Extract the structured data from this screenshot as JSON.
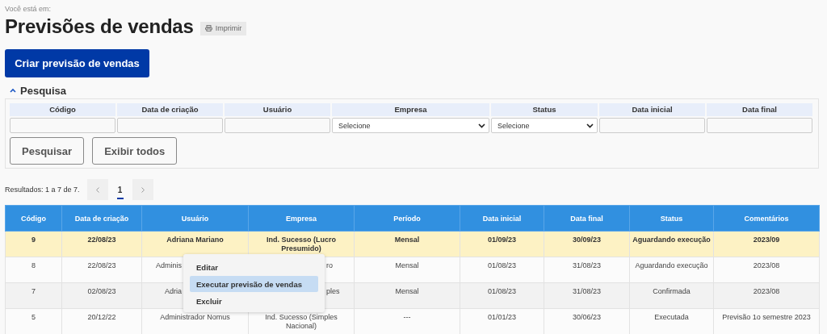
{
  "breadcrumb_label": "Você está em:",
  "title": "Previsões de vendas",
  "print_button": "Imprimir",
  "create_button": "Criar previsão de vendas",
  "search": {
    "label": "Pesquisa",
    "expanded": true,
    "filters": [
      {
        "label": "Código",
        "kind": "text"
      },
      {
        "label": "Data de criação",
        "kind": "text"
      },
      {
        "label": "Usuário",
        "kind": "text"
      },
      {
        "label": "Empresa",
        "kind": "select",
        "value": "Selecione"
      },
      {
        "label": "Status",
        "kind": "select",
        "value": "Selecione"
      },
      {
        "label": "Data inicial",
        "kind": "text"
      },
      {
        "label": "Data final",
        "kind": "text"
      }
    ],
    "buttons": [
      "Pesquisar",
      "Exibir todos"
    ]
  },
  "pagination": {
    "summary": "Resultados: 1 a 7 de 7.",
    "pages": [
      {
        "label": "1",
        "selected": true
      }
    ]
  },
  "table": {
    "columns": [
      "Código",
      "Data de criação",
      "Usuário",
      "Empresa",
      "Período",
      "Data inicial",
      "Data final",
      "Status",
      "Comentários"
    ],
    "rows": [
      {
        "selected": true,
        "cells": [
          "9",
          "22/08/23",
          "Adriana Mariano",
          "Ind. Sucesso (Lucro Presumido)",
          "Mensal",
          "01/09/23",
          "30/09/23",
          "Aguardando execução",
          "2023/09"
        ]
      },
      {
        "selected": false,
        "cells": [
          "8",
          "22/08/23",
          {
            "text": "Adminis",
            "covered_end": true
          },
          {
            "text": "ro",
            "covered_start": true
          },
          "Mensal",
          "01/08/23",
          "31/08/23",
          "Aguardando execução",
          "2023/08"
        ]
      },
      {
        "selected": false,
        "cells": [
          "7",
          "02/08/23",
          {
            "text": "Adria",
            "covered_end": true
          },
          {
            "text": "ples",
            "covered_start": true
          },
          "Mensal",
          "01/08/23",
          "31/08/23",
          "Confirmada",
          "2023/08"
        ]
      },
      {
        "selected": false,
        "cells": [
          "5",
          "20/12/22",
          "Administrador Nomus",
          "Ind. Sucesso (Simples Nacional)",
          "---",
          "01/01/23",
          "30/06/23",
          "Executada",
          "Previsão 1o semestre 2023"
        ]
      }
    ]
  },
  "context_menu": {
    "items": [
      {
        "label": "Editar",
        "selected": false
      },
      {
        "label": "Executar previsão de vendas",
        "selected": true
      },
      {
        "label": "Excluir",
        "selected": false
      }
    ]
  }
}
